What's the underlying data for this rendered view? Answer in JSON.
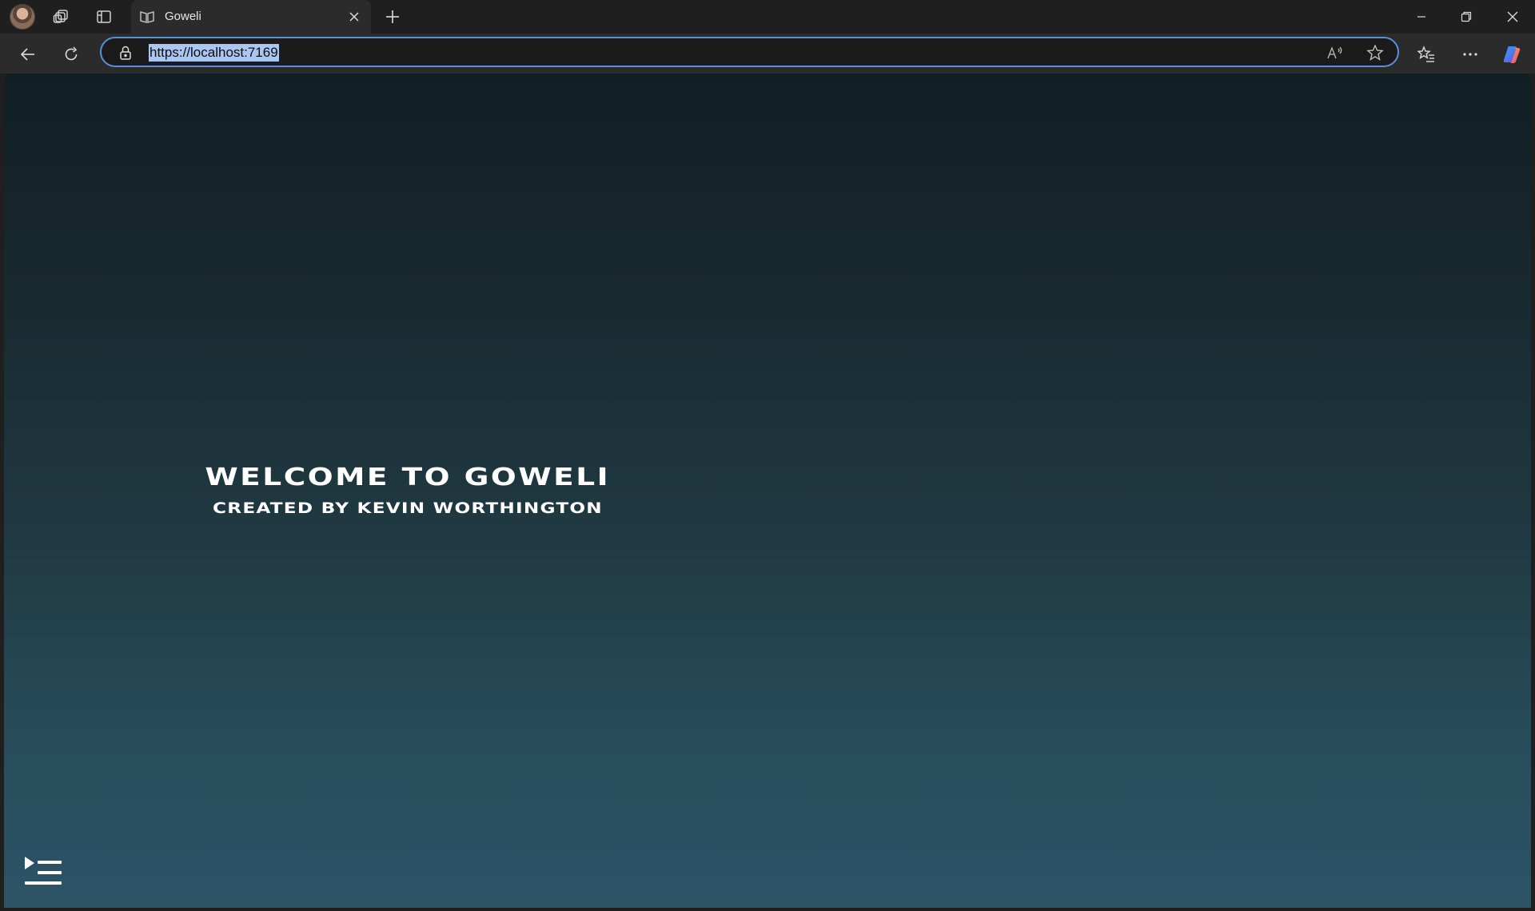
{
  "browser": {
    "tab": {
      "title": "Goweli"
    },
    "address_bar": {
      "url": "https://localhost:7169"
    },
    "icons": {
      "profile": "avatar",
      "workspaces": "workspaces-icon",
      "tab_actions": "vertical-tabs-icon",
      "favicon": "book-icon",
      "close_tab": "close-icon",
      "new_tab": "plus-icon",
      "minimize": "minimize-icon",
      "restore": "restore-icon",
      "close_window": "close-icon",
      "back": "back-arrow-icon",
      "refresh": "refresh-icon",
      "lock": "lock-icon",
      "read_aloud": "read-aloud-icon",
      "favorite": "star-icon",
      "favorites": "favorites-list-icon",
      "more": "more-icon",
      "copilot": "copilot-icon"
    },
    "accent_color": "#5b8fd8"
  },
  "page": {
    "title": "WELCOME TO GOWELI",
    "subtitle": "CREATED BY KEVIN WORTHINGTON",
    "background_top": "#111f25",
    "background_bottom": "#2c5467",
    "menu_icon": "menu-toggle-icon"
  }
}
